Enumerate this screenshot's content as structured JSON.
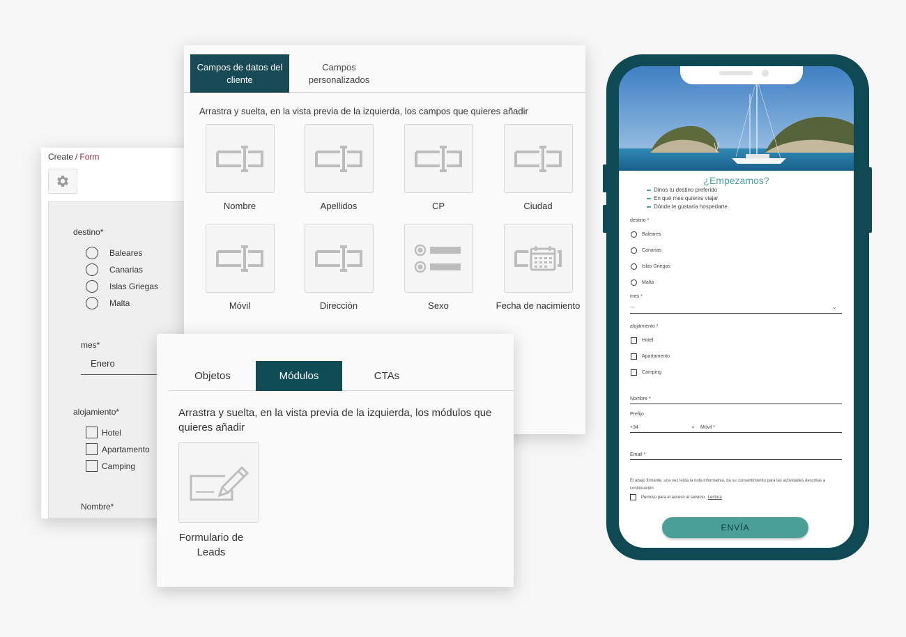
{
  "breadcrumb": {
    "root": "Create",
    "separator": "/",
    "current": "Form"
  },
  "form_preview": {
    "destino_label": "destino*",
    "destinos": [
      "Baleares",
      "Canarias",
      "Islas Griegas",
      "Malta"
    ],
    "mes_label": "mes*",
    "mes_value": "Enero",
    "alojamiento_label": "alojamiento*",
    "alojamientos": [
      "Hotel",
      "Apartamento",
      "Camping"
    ],
    "nombre_label": "Nombre*"
  },
  "fields_panel": {
    "tabs": [
      {
        "label": "Campos de datos del cliente",
        "active": true
      },
      {
        "label": "Campos personalizados",
        "active": false
      }
    ],
    "instruction": "Arrastra y suelta, en la vista previa de la izquierda, los campos que quieres añadir",
    "fields": [
      {
        "label": "Nombre",
        "icon": "text-field-icon"
      },
      {
        "label": "Apellidos",
        "icon": "text-field-icon"
      },
      {
        "label": "CP",
        "icon": "text-field-icon"
      },
      {
        "label": "Ciudad",
        "icon": "text-field-icon"
      },
      {
        "label": "Móvil",
        "icon": "text-field-icon"
      },
      {
        "label": "Dirección",
        "icon": "text-field-icon"
      },
      {
        "label": "Sexo",
        "icon": "radio-list-icon"
      },
      {
        "label": "Fecha de nacimiento",
        "icon": "date-field-icon"
      }
    ]
  },
  "modules_panel": {
    "tabs": [
      {
        "label": "Objetos",
        "active": false
      },
      {
        "label": "Módulos",
        "active": true
      },
      {
        "label": "CTAs",
        "active": false
      }
    ],
    "instruction": "Arrastra y suelta, en la vista previa de la izquierda, los módulos que quieres añadir",
    "module": {
      "label": "Formulario de Leads",
      "icon": "signature-form-icon"
    }
  },
  "phone_form": {
    "title": "¿Empezamos?",
    "bullets": [
      "Dinos tu destino preferido",
      "En qué mes quieres viajar",
      "Dónde te gustaría hospedarte"
    ],
    "destino_label": "destino *",
    "destinos": [
      "Baleares",
      "Canarias",
      "Islas Griegas",
      "Malta"
    ],
    "mes_label": "mes *",
    "mes_value": "---",
    "alojamiento_label": "alojamiento *",
    "alojamientos": [
      "Hotel",
      "Apartamento",
      "Camping"
    ],
    "nombre_label": "Nombre *",
    "prefijo_label": "Prefijo",
    "prefijo_value": "+34",
    "movil_label": "Móvil *",
    "email_label": "Email *",
    "consent_text": "El abajo firmante, una vez leída la nota informativa, da su consentimiento para las actividades descritas a continuación:",
    "permission_text": "Permiso para el acceso al servicio.",
    "permission_link": "Lectura",
    "submit_label": "ENVÍA"
  },
  "colors": {
    "active_tab": "#184a55",
    "phone_frame": "#0f4a54",
    "accent_teal": "#4a9f99",
    "breadcrumb_active": "#8c2a3a"
  }
}
